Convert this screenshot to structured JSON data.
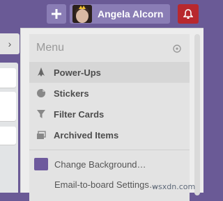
{
  "header": {
    "add_icon": "plus-icon",
    "member": {
      "name": "Angela Alcorn",
      "avatar": "avatar-photo"
    },
    "notifications_icon": "bell-icon",
    "colors": {
      "board_bg": "#6a5a96",
      "button_bg": "#8a7db5",
      "notif_bg": "#b8282e"
    }
  },
  "sidebar_toggle": {
    "icon": "chevron-right-icon",
    "glyph": "›"
  },
  "menu": {
    "title": "Menu",
    "close_icon": "close-circle-icon",
    "items": [
      {
        "label": "Power-Ups",
        "icon": "rocket-icon",
        "active": true
      },
      {
        "label": "Stickers",
        "icon": "sticker-icon",
        "active": false
      },
      {
        "label": "Filter Cards",
        "icon": "filter-icon",
        "active": false
      },
      {
        "label": "Archived Items",
        "icon": "archive-icon",
        "active": false
      }
    ],
    "links": [
      {
        "label": "Change Background…",
        "swatch_color": "#6e5a9d"
      },
      {
        "label": "Email-to-board Settings…"
      }
    ]
  },
  "watermark": "wsxdn.com"
}
